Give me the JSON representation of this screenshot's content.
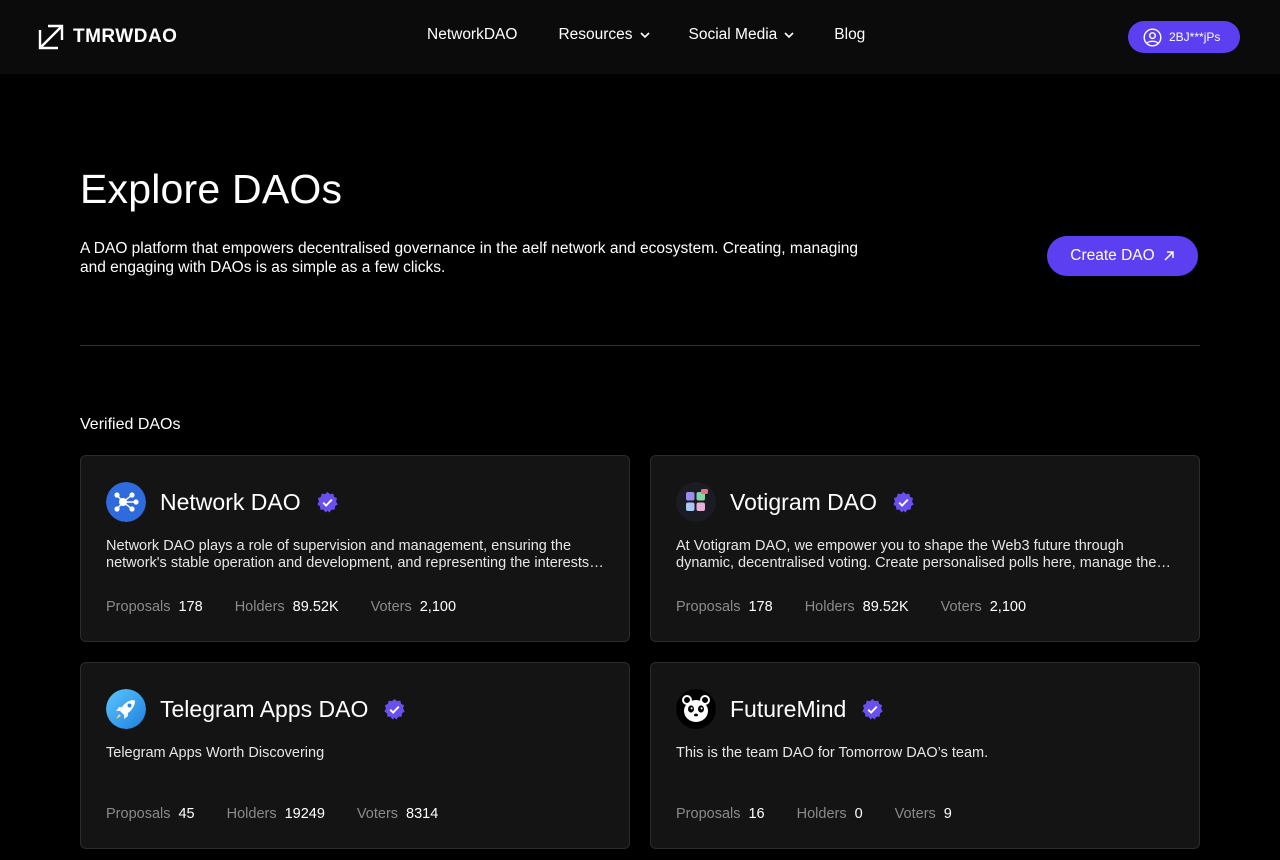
{
  "header": {
    "logo_text": "TMRWDAO",
    "nav": [
      {
        "label": "NetworkDAO",
        "has_dropdown": false
      },
      {
        "label": "Resources",
        "has_dropdown": true
      },
      {
        "label": "Social Media",
        "has_dropdown": true
      },
      {
        "label": "Blog",
        "has_dropdown": false
      }
    ],
    "wallet_label": "2BJ***jPs"
  },
  "hero": {
    "title": "Explore DAOs",
    "description": "A DAO platform that empowers decentralised governance in the aelf network and ecosystem. Creating, managing and engaging with DAOs is as simple as a few clicks.",
    "create_button": "Create DAO"
  },
  "section": {
    "label": "Verified DAOs"
  },
  "stat_labels": {
    "proposals": "Proposals",
    "holders": "Holders",
    "voters": "Voters"
  },
  "daos": [
    {
      "name": "Network DAO",
      "description": "Network DAO plays a role of supervision and management, ensuring the network's stable operation and development, and representing the interests of the community and ecosystem participants.",
      "proposals": "178",
      "holders": "89.52K",
      "voters": "2,100",
      "icon": "network-dao-logo"
    },
    {
      "name": "Votigram DAO",
      "description": "At Votigram DAO, we empower you to shape the Web3 future through dynamic, decentralised voting. Create personalised polls here, manage them and engage with the community.",
      "proposals": "178",
      "holders": "89.52K",
      "voters": "2,100",
      "icon": "votigram-dao-logo"
    },
    {
      "name": "Telegram Apps DAO",
      "description": "Telegram Apps Worth Discovering",
      "proposals": "45",
      "holders": "19249",
      "voters": "8314",
      "icon": "telegram-apps-rocket-logo"
    },
    {
      "name": "FutureMind",
      "description": "This is the team DAO for Tomorrow DAO’s team.",
      "proposals": "16",
      "holders": "0",
      "voters": "9",
      "icon": "futuremind-panda-logo"
    }
  ],
  "colors": {
    "background": "#000000",
    "header_bg": "#0b0b0b",
    "card_bg": "#141414",
    "card_border": "#2c2c2c",
    "accent": "#5b3ff1",
    "verified_badge": "#6a4ff0",
    "muted_text": "#8a8a8a"
  }
}
